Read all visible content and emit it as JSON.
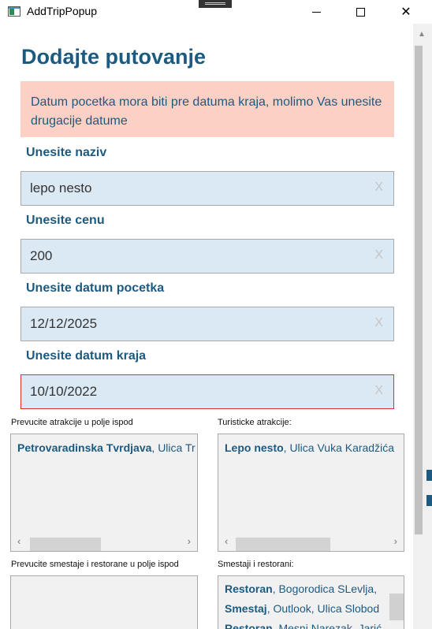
{
  "window": {
    "title": "AddTripPopup",
    "controls": {
      "minimize": "minimize",
      "maximize": "maximize",
      "close": "✕"
    }
  },
  "form": {
    "heading": "Dodajte putovanje",
    "error": "Datum pocetka mora biti pre datuma kraja, molimo Vas unesite drugacije datume",
    "fields": [
      {
        "label": "Unesite naziv",
        "value": "lepo nesto"
      },
      {
        "label": "Unesite cenu",
        "value": "200"
      },
      {
        "label": "Unesite datum pocetka",
        "value": "12/12/2025"
      },
      {
        "label": "Unesite datum kraja",
        "value": "10/10/2022"
      }
    ],
    "clear_glyph": "X"
  },
  "lists": {
    "drag_attractions": {
      "caption": "Prevucite atrakcije u polje ispod",
      "items": [
        {
          "name": "Petrovaradinska Tvrdjava",
          "address": ", Ulica Tr"
        }
      ]
    },
    "tourist_attractions": {
      "caption": "Turisticke atrakcije:",
      "items": [
        {
          "name": "Lepo nesto",
          "address": ", Ulica Vuka Karadžića"
        }
      ]
    },
    "drag_accommodation": {
      "caption": "Prevucite smestaje i restorane u polje ispod",
      "items": []
    },
    "accommodation_restaurants": {
      "caption": "Smestaji i restorani:",
      "items": [
        {
          "name": "Restoran",
          "address": ", Bogorodica SLevlja, "
        },
        {
          "name": "Smestaj",
          "address": ", Outlook, Ulica Slobod"
        },
        {
          "name": "Restoran",
          "address": ", Mesni Narezak, Jarić"
        }
      ]
    }
  },
  "scroll_arrows": {
    "left": "‹",
    "right": "›",
    "up": "▲"
  }
}
